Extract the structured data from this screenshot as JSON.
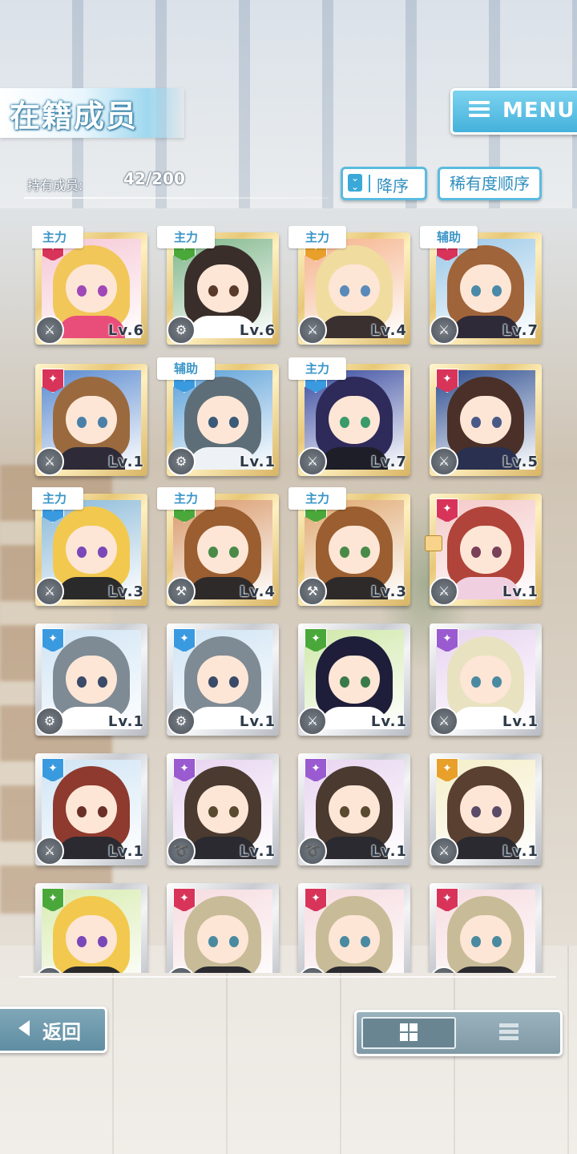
{
  "header": {
    "title": "在籍成员",
    "menu_label": "MENU"
  },
  "members_info": {
    "label": "持有成员:",
    "count": "42/200"
  },
  "sort": {
    "order_label": "降序",
    "rarity_label": "稀有度顺序"
  },
  "cards": [
    {
      "role": "主力",
      "level": "Lv.6",
      "frame": "gold",
      "attr": "red",
      "hair": "#f2c75a",
      "eye": "#a048b8",
      "outfit": "#e94d7a",
      "bg": "#f6c7d4",
      "weapon": "sword",
      "locked": false
    },
    {
      "role": "主力",
      "level": "Lv.6",
      "frame": "gold",
      "attr": "green",
      "hair": "#3a2e2a",
      "eye": "#5a3a2a",
      "outfit": "#ffffff",
      "bg": "#7fb68a",
      "weapon": "gear",
      "locked": false
    },
    {
      "role": "主力",
      "level": "Lv.4",
      "frame": "gold",
      "attr": "orange",
      "hair": "#f1dca0",
      "eye": "#5a8ab8",
      "outfit": "#3a3030",
      "bg": "#f5b28a",
      "weapon": "sword",
      "locked": false
    },
    {
      "role": "辅助",
      "level": "Lv.7",
      "frame": "gold",
      "attr": "red",
      "hair": "#a0643a",
      "eye": "#4a8aa8",
      "outfit": "#2e2a38",
      "bg": "#9ac8e8",
      "weapon": "sword",
      "locked": false
    },
    {
      "role": "",
      "level": "Lv.1",
      "frame": "gold",
      "attr": "red",
      "hair": "#9a6a3e",
      "eye": "#4a80a8",
      "outfit": "#2e2a38",
      "bg": "#5a8ad0",
      "weapon": "sword",
      "locked": false
    },
    {
      "role": "辅助",
      "level": "Lv.1",
      "frame": "gold",
      "attr": "blue",
      "hair": "#5e6e78",
      "eye": "#3a5a78",
      "outfit": "#eef2f6",
      "bg": "#5aa0d8",
      "weapon": "gear",
      "locked": false
    },
    {
      "role": "主力",
      "level": "Lv.7",
      "frame": "gold",
      "attr": "blue",
      "hair": "#2e2a5a",
      "eye": "#3a9a6a",
      "outfit": "#1e1e28",
      "bg": "#3a4ca0",
      "weapon": "sword",
      "locked": false
    },
    {
      "role": "",
      "level": "Lv.5",
      "frame": "gold",
      "attr": "red",
      "hair": "#4a3028",
      "eye": "#4a5a88",
      "outfit": "#2a3050",
      "bg": "#2e4e90",
      "weapon": "sword",
      "locked": false
    },
    {
      "role": "主力",
      "level": "Lv.3",
      "frame": "gold",
      "attr": "blue",
      "hair": "#f2c94e",
      "eye": "#7a48b8",
      "outfit": "#2a2a2a",
      "bg": "#88b8d8",
      "weapon": "sword",
      "locked": false
    },
    {
      "role": "主力",
      "level": "Lv.4",
      "frame": "gold",
      "attr": "green",
      "hair": "#9a5e30",
      "eye": "#4a8a48",
      "outfit": "#2e2a2a",
      "bg": "#d89868",
      "weapon": "axe",
      "locked": false
    },
    {
      "role": "主力",
      "level": "Lv.3",
      "frame": "gold",
      "attr": "green",
      "hair": "#9a5e30",
      "eye": "#4a8a48",
      "outfit": "#2e2a2a",
      "bg": "#e0a870",
      "weapon": "axe",
      "locked": false
    },
    {
      "role": "",
      "level": "Lv.1",
      "frame": "gold",
      "attr": "red",
      "hair": "#b0443a",
      "eye": "#7a4058",
      "outfit": "#f0d0e0",
      "bg": "#f4c8c8",
      "weapon": "sword",
      "locked": true
    },
    {
      "role": "",
      "level": "Lv.1",
      "frame": "silver",
      "attr": "blue",
      "hair": "#7e8a94",
      "eye": "#3a4a68",
      "outfit": "#ffffff",
      "bg": "#cfe4f4",
      "weapon": "gear",
      "locked": false
    },
    {
      "role": "",
      "level": "Lv.1",
      "frame": "silver",
      "attr": "blue",
      "hair": "#7e8a94",
      "eye": "#3a4a68",
      "outfit": "#ffffff",
      "bg": "#cfe4f4",
      "weapon": "gear",
      "locked": false
    },
    {
      "role": "",
      "level": "Lv.1",
      "frame": "silver",
      "attr": "green",
      "hair": "#1e1e3a",
      "eye": "#3a7a4a",
      "outfit": "#ffffff",
      "bg": "#cfe8a8",
      "weapon": "sword",
      "locked": false
    },
    {
      "role": "",
      "level": "Lv.1",
      "frame": "silver",
      "attr": "purple",
      "hair": "#e8e2c0",
      "eye": "#4a8aa0",
      "outfit": "#ffffff",
      "bg": "#e8d4f0",
      "weapon": "sword",
      "locked": false
    },
    {
      "role": "",
      "level": "Lv.1",
      "frame": "silver",
      "attr": "blue",
      "hair": "#8e3a2e",
      "eye": "#6a3028",
      "outfit": "#2a2a30",
      "bg": "#cfe4f4",
      "weapon": "sword",
      "locked": false
    },
    {
      "role": "",
      "level": "Lv.1",
      "frame": "silver",
      "attr": "purple",
      "hair": "#4a3a30",
      "eye": "#5a4a30",
      "outfit": "#2a2a30",
      "bg": "#e8d4f0",
      "weapon": "whip",
      "locked": false
    },
    {
      "role": "",
      "level": "Lv.1",
      "frame": "silver",
      "attr": "purple",
      "hair": "#4a3a30",
      "eye": "#5a4a30",
      "outfit": "#2a2a30",
      "bg": "#e8d4f0",
      "weapon": "whip",
      "locked": false
    },
    {
      "role": "",
      "level": "Lv.1",
      "frame": "silver",
      "attr": "orange",
      "hair": "#5a4030",
      "eye": "#5a4a68",
      "outfit": "#2a2a30",
      "bg": "#f4eec8",
      "weapon": "sword",
      "locked": false
    },
    {
      "role": "",
      "level": "",
      "frame": "silver",
      "attr": "green",
      "hair": "#f2c94e",
      "eye": "#7a48b8",
      "outfit": "#2a2a2a",
      "bg": "#d8ecb0",
      "weapon": "sword",
      "locked": false
    },
    {
      "role": "",
      "level": "",
      "frame": "silver",
      "attr": "red",
      "hair": "#c8bc98",
      "eye": "#4a8aa0",
      "outfit": "#2a2a30",
      "bg": "#f6dce0",
      "weapon": "sword",
      "locked": false
    },
    {
      "role": "",
      "level": "",
      "frame": "silver",
      "attr": "red",
      "hair": "#c8bc98",
      "eye": "#4a8aa0",
      "outfit": "#2a2a30",
      "bg": "#f6dce0",
      "weapon": "sword",
      "locked": false
    },
    {
      "role": "",
      "level": "",
      "frame": "silver",
      "attr": "red",
      "hair": "#c8bc98",
      "eye": "#4a8aa0",
      "outfit": "#2a2a30",
      "bg": "#f6dce0",
      "weapon": "sword",
      "locked": false
    }
  ],
  "attr_colors": {
    "red": "#d8345a",
    "green": "#4aa83a",
    "orange": "#e8a02a",
    "blue": "#3a9ae0",
    "purple": "#9a5ad0"
  },
  "footer": {
    "back_label": "返回"
  }
}
